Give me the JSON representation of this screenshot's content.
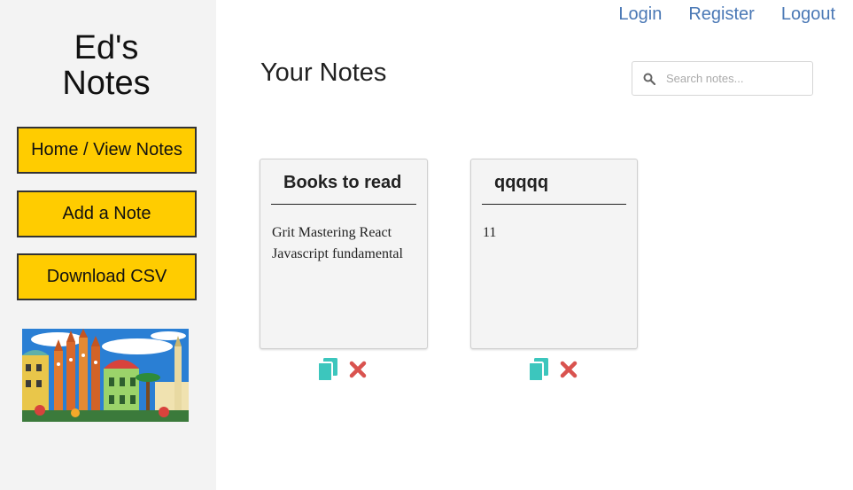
{
  "brand": {
    "line1": "Ed's",
    "line2": "Notes"
  },
  "sidebar": {
    "buttons": [
      "Home / View Notes",
      "Add a Note",
      "Download CSV"
    ]
  },
  "nav": {
    "login": "Login",
    "register": "Register",
    "logout": "Logout"
  },
  "page_title": "Your Notes",
  "search": {
    "placeholder": "Search notes..."
  },
  "notes": [
    {
      "title": "Books to read",
      "body": "Grit Mastering React Javascript fundamental"
    },
    {
      "title": "qqqqq",
      "body": "11"
    }
  ],
  "colors": {
    "accent": "#ffcc00",
    "link": "#4a78b5",
    "copy": "#3cc6bd",
    "delete": "#d9534f"
  },
  "icons": {
    "copy": "copy-icon",
    "delete": "delete-icon",
    "search": "search-icon"
  }
}
